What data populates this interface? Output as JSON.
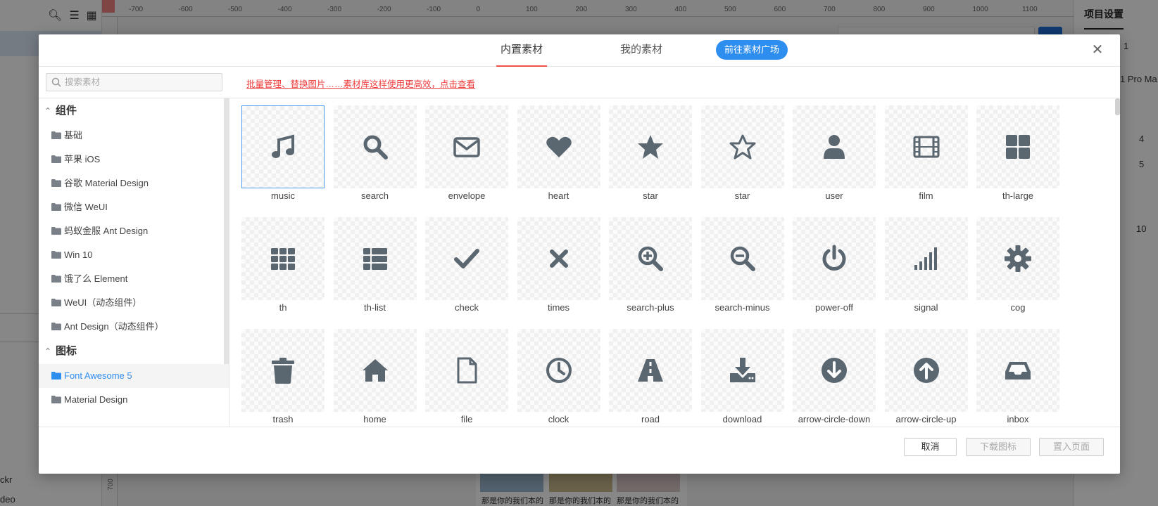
{
  "background": {
    "ruler_ticks": [
      "-700",
      "-600",
      "-500",
      "-400",
      "-300",
      "-200",
      "-100",
      "0",
      "100",
      "200",
      "300",
      "400",
      "500",
      "600",
      "700",
      "800",
      "900",
      "1000",
      "1100"
    ],
    "left_ruler_tick": "700",
    "right_panel": {
      "title": "项目设置",
      "t1": "1",
      "t2": "1 Pro Ma",
      "t3": "4",
      "t4": "5",
      "t5": "10"
    },
    "left_texts": {
      "t1": "ckr",
      "t2": "deo"
    },
    "canvas_caps": [
      "那是你的我们本的",
      "那是你的我们本的",
      "那是你的我们本的"
    ]
  },
  "modal": {
    "tabs": {
      "builtin": "内置素材",
      "mine": "我的素材"
    },
    "plaza_button": "前往素材广场",
    "close": "✕",
    "search": {
      "placeholder": "搜索素材",
      "value": ""
    },
    "promo": "批量管理、替换图片……素材库这样使用更高效，点击查看",
    "sidebar": {
      "group_components": "组件",
      "components": [
        "基础",
        "苹果 iOS",
        "谷歌 Material Design",
        "微信 WeUI",
        "蚂蚁金服 Ant Design",
        "Win 10",
        "饿了么 Element",
        "WeUI（动态组件）",
        "Ant Design（动态组件）"
      ],
      "group_icons": "图标",
      "icons": [
        "Font Awesome 5",
        "Material Design"
      ],
      "active_item": "Font Awesome 5"
    },
    "icon_color": "#5a6670",
    "accent_color": "#2e8ef0",
    "grid": [
      {
        "name": "music",
        "label": "music"
      },
      {
        "name": "search",
        "label": "search"
      },
      {
        "name": "envelope",
        "label": "envelope"
      },
      {
        "name": "heart",
        "label": "heart"
      },
      {
        "name": "star",
        "label": "star"
      },
      {
        "name": "star-outline",
        "label": "star"
      },
      {
        "name": "user",
        "label": "user"
      },
      {
        "name": "film",
        "label": "film"
      },
      {
        "name": "th-large",
        "label": "th-large"
      },
      {
        "name": "th",
        "label": "th"
      },
      {
        "name": "th-list",
        "label": "th-list"
      },
      {
        "name": "check",
        "label": "check"
      },
      {
        "name": "times",
        "label": "times"
      },
      {
        "name": "search-plus",
        "label": "search-plus"
      },
      {
        "name": "search-minus",
        "label": "search-minus"
      },
      {
        "name": "power-off",
        "label": "power-off"
      },
      {
        "name": "signal",
        "label": "signal"
      },
      {
        "name": "cog",
        "label": "cog"
      },
      {
        "name": "trash",
        "label": "trash"
      },
      {
        "name": "home",
        "label": "home"
      },
      {
        "name": "file",
        "label": "file"
      },
      {
        "name": "clock",
        "label": "clock"
      },
      {
        "name": "road",
        "label": "road"
      },
      {
        "name": "download",
        "label": "download"
      },
      {
        "name": "arrow-circle-down",
        "label": "arrow-circle-down"
      },
      {
        "name": "arrow-circle-up",
        "label": "arrow-circle-up"
      },
      {
        "name": "inbox",
        "label": "inbox"
      }
    ],
    "footer": {
      "cancel": "取消",
      "download": "下载图标",
      "place": "置入页面"
    }
  }
}
